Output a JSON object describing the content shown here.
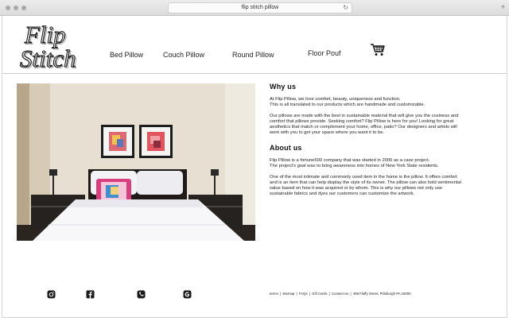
{
  "browser": {
    "url": "flip stitch pillow",
    "reload_icon": "reload-icon",
    "newtab_label": "+"
  },
  "brand": {
    "line1": "Flip",
    "line2": "Stitch"
  },
  "nav": {
    "items": [
      "Bed Pillow",
      "Couch Pillow",
      "Round Pillow",
      "Floor Pouf"
    ],
    "cart_icon": "shopping-cart-icon"
  },
  "about": {
    "why_title": "Why us",
    "why_p1_l1": "At Flip Pillow, we love comfort, beauty, uniqueness and function.",
    "why_p1_l2": "This is all translated to our products which are handmade and customizable.",
    "why_p2_l1": "Our pillows are made with the best in sustainable material that will give you the coziness and",
    "why_p2_l2": "comfort that pillows provide.  Seeking comfort? Flip Pillow is here for you! Looking for great",
    "why_p2_l3": "aesthetics that match or complement your home, office, patio?  Our designers and artists will",
    "why_p2_l4": "work with you to get your space where you want it to be.",
    "about_title": "About us",
    "about_p1_l1": "Flip Pillow is a fortune500 company that was started in 2006 as a case project.",
    "about_p1_l2": "The project's goal was to bring awareness into homes of New York State residents.",
    "about_p2_l1": "One of the most intimate and commonly used item in the home is the pillow. It offers comfort",
    "about_p2_l2": "and is an item that can help display the style of its owner. The pillow can also hold sentimental",
    "about_p2_l3": "value based on how it was acquired or by whom. This is why our pillows not only use",
    "about_p2_l4": "sustainable fabrics and dyes our customers can customize the artwork."
  },
  "footer": {
    "social_icons": [
      "instagram-icon",
      "facebook-icon",
      "phone-icon",
      "google-icon"
    ],
    "links": {
      "terms": "terms",
      "sitemap": "sitemap",
      "faqs": "FAQs",
      "gift_cards": "Gift Cards",
      "contact": "Contact Us",
      "address": "459 Fluffy Street, Pittsburgh PA 15000",
      "sep": "|"
    }
  },
  "colors": {
    "text": "#222222",
    "wall": "#e4dccd",
    "bed_white": "#f6f6f8",
    "accent_pink": "#e04b86"
  }
}
